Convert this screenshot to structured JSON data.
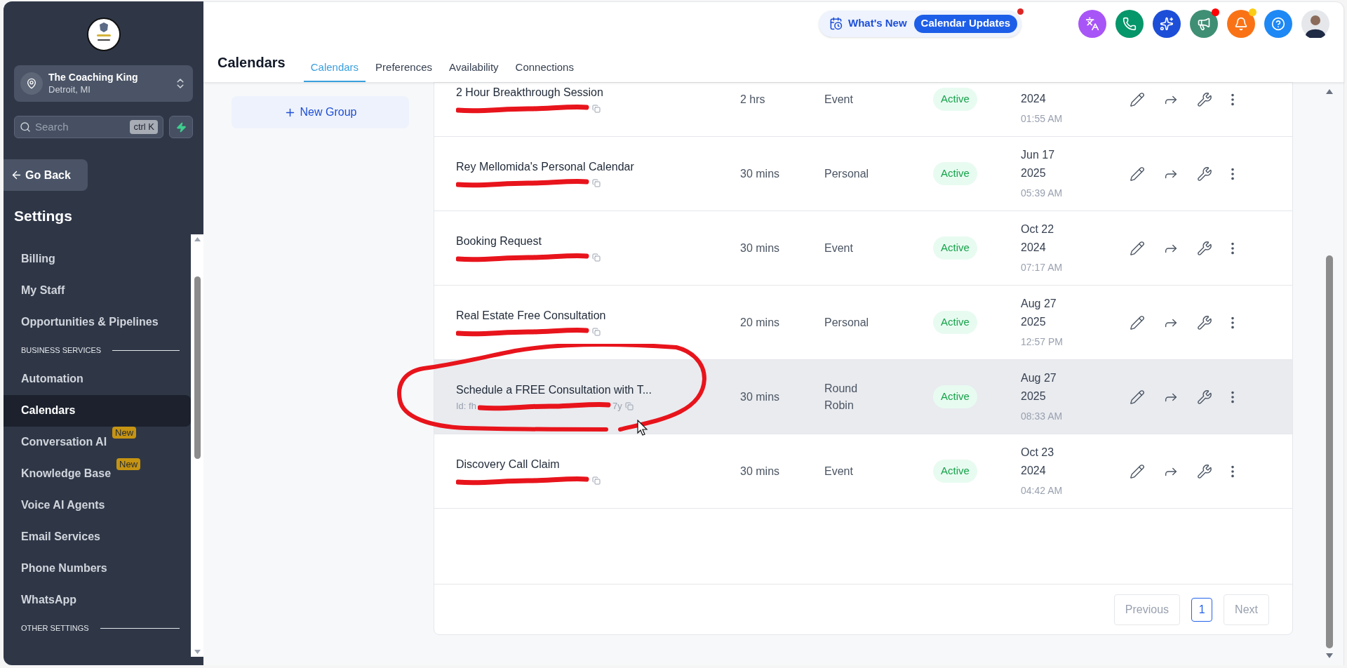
{
  "sidebar": {
    "account": {
      "name": "The Coaching King",
      "location": "Detroit, MI"
    },
    "search": {
      "placeholder": "Search",
      "shortcut": "ctrl K"
    },
    "back_button": "Go Back",
    "title": "Settings",
    "items": [
      {
        "kind": "item",
        "label": "Billing",
        "selected": false
      },
      {
        "kind": "item",
        "label": "My Staff",
        "selected": false
      },
      {
        "kind": "item",
        "label": "Opportunities & Pipelines",
        "selected": false
      },
      {
        "kind": "section",
        "label": "BUSINESS SERVICES"
      },
      {
        "kind": "item",
        "label": "Automation",
        "selected": false
      },
      {
        "kind": "item",
        "label": "Calendars",
        "selected": true
      },
      {
        "kind": "item",
        "label": "Conversation AI",
        "badge": "New",
        "selected": false
      },
      {
        "kind": "item",
        "label": "Knowledge Base",
        "badge": "New",
        "selected": false
      },
      {
        "kind": "item",
        "label": "Voice AI Agents",
        "selected": false
      },
      {
        "kind": "item",
        "label": "Email Services",
        "selected": false
      },
      {
        "kind": "item",
        "label": "Phone Numbers",
        "selected": false
      },
      {
        "kind": "item",
        "label": "WhatsApp",
        "selected": false
      },
      {
        "kind": "section",
        "label": "OTHER SETTINGS"
      }
    ]
  },
  "header": {
    "title": "Calendars",
    "tabs": [
      {
        "label": "Calendars",
        "selected": true
      },
      {
        "label": "Preferences",
        "selected": false
      },
      {
        "label": "Availability",
        "selected": false
      },
      {
        "label": "Connections",
        "selected": false
      }
    ],
    "whats_new": {
      "label": "What's New",
      "pill": "Calendar Updates",
      "notification": true
    },
    "icons": [
      {
        "kind": "translate",
        "color": "#a855f7"
      },
      {
        "kind": "phone",
        "color": "#059669"
      },
      {
        "kind": "sparkle",
        "color": "#1d4ed8"
      },
      {
        "kind": "megaphone",
        "color": "#3f8f74",
        "dot": {
          "color": "#ff0000"
        }
      },
      {
        "kind": "bell",
        "color": "#f97316",
        "dot": {
          "color": "#facc15"
        }
      },
      {
        "kind": "help",
        "color": "#1e88f5"
      }
    ]
  },
  "new_group_button": "New Group",
  "table": {
    "rows": [
      {
        "name": "2 Hour Breakthrough Session",
        "duration": "2 hrs",
        "type": "Event",
        "status": "Active",
        "year": "2024",
        "time": "01:55 AM",
        "highlighted": false
      },
      {
        "name": "Rey Mellomida's Personal Calendar",
        "duration": "30 mins",
        "type": "Personal",
        "status": "Active",
        "date": "Jun 17",
        "year": "2025",
        "time": "05:39 AM",
        "highlighted": false
      },
      {
        "name": "Booking Request",
        "duration": "30 mins",
        "type": "Event",
        "status": "Active",
        "date": "Oct 22",
        "year": "2024",
        "time": "07:17 AM",
        "highlighted": false
      },
      {
        "name": "Real Estate Free Consultation",
        "duration": "20 mins",
        "type": "Personal",
        "status": "Active",
        "date": "Aug 27",
        "year": "2025",
        "time": "12:57 PM",
        "highlighted": false
      },
      {
        "name": "Schedule a FREE Consultation with T...",
        "id_parts": [
          "Id: fh",
          "7y"
        ],
        "duration": "30 mins",
        "type": "Round Robin",
        "status": "Active",
        "date": "Aug 27",
        "year": "2025",
        "time": "08:33 AM",
        "highlighted": true
      },
      {
        "name": "Discovery Call Claim",
        "duration": "30 mins",
        "type": "Event",
        "status": "Active",
        "date": "Oct 23",
        "year": "2024",
        "time": "04:42 AM",
        "highlighted": false
      }
    ]
  },
  "pagination": {
    "previous": {
      "label": "Previous",
      "disabled": true
    },
    "pages": [
      {
        "label": "1",
        "selected": true
      }
    ],
    "next": {
      "label": "Next",
      "disabled": true
    }
  }
}
